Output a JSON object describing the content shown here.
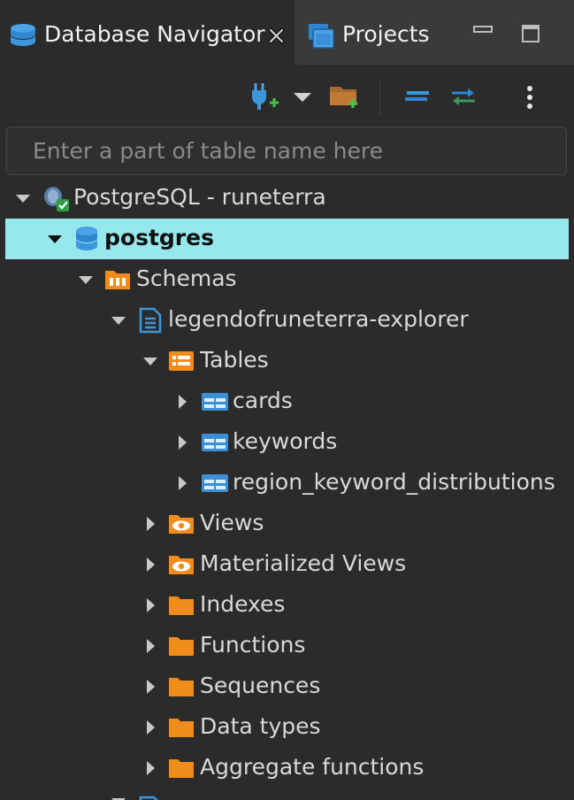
{
  "tabs": [
    {
      "label": "Database Navigator",
      "icon": "database-icon",
      "active": true
    },
    {
      "label": "Projects",
      "icon": "projects-icon",
      "active": false
    }
  ],
  "toolbar": {
    "icons": [
      "new-connection-icon",
      "dropdown-arrow-icon",
      "new-folder-icon",
      "collapse-all-icon",
      "link-with-editor-icon",
      "more-menu-icon"
    ]
  },
  "search": {
    "placeholder": "Enter a part of table name here"
  },
  "tree": [
    {
      "label": "PostgreSQL - runeterra",
      "icon": "postgresql-connection-icon",
      "expanded": true,
      "selected": false
    },
    {
      "label": "postgres",
      "icon": "database-icon",
      "expanded": true,
      "selected": true
    },
    {
      "label": "Schemas",
      "icon": "schemas-folder-icon",
      "expanded": true,
      "selected": false
    },
    {
      "label": "legendofruneterra-explorer",
      "icon": "schema-icon",
      "expanded": true,
      "selected": false
    },
    {
      "label": "Tables",
      "icon": "tables-folder-icon",
      "expanded": true,
      "selected": false
    },
    {
      "label": "cards",
      "icon": "table-icon",
      "expanded": false,
      "selected": false
    },
    {
      "label": "keywords",
      "icon": "table-icon",
      "expanded": false,
      "selected": false
    },
    {
      "label": "region_keyword_distributions",
      "icon": "table-icon",
      "expanded": false,
      "selected": false
    },
    {
      "label": "Views",
      "icon": "views-folder-icon",
      "expanded": false,
      "selected": false
    },
    {
      "label": "Materialized Views",
      "icon": "views-folder-icon",
      "expanded": false,
      "selected": false
    },
    {
      "label": "Indexes",
      "icon": "folder-icon",
      "expanded": false,
      "selected": false
    },
    {
      "label": "Functions",
      "icon": "folder-icon",
      "expanded": false,
      "selected": false
    },
    {
      "label": "Sequences",
      "icon": "folder-icon",
      "expanded": false,
      "selected": false
    },
    {
      "label": "Data types",
      "icon": "folder-icon",
      "expanded": false,
      "selected": false
    },
    {
      "label": "Aggregate functions",
      "icon": "folder-icon",
      "expanded": false,
      "selected": false
    }
  ],
  "colors": {
    "accent": "#97e8ec",
    "background": "#2b2b2b",
    "folder": "#f08c1c",
    "table": "#3b8fd6"
  }
}
